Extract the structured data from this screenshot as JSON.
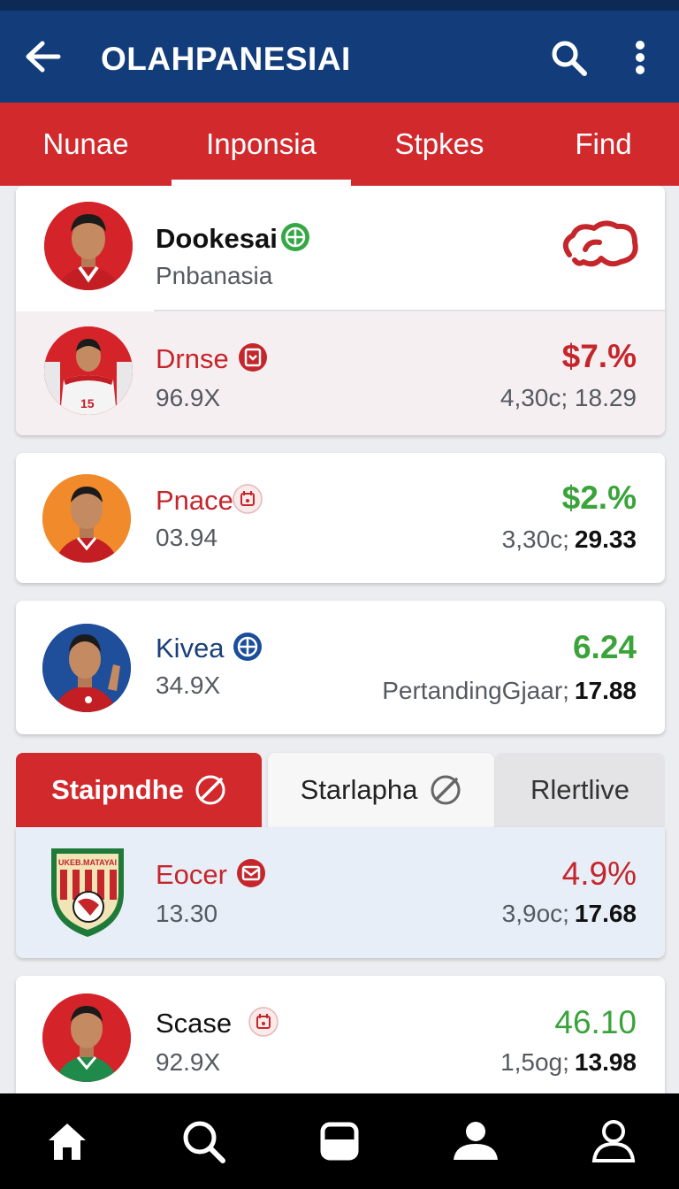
{
  "app_bar": {
    "title": "OLAHPANESIAI"
  },
  "tabs": [
    {
      "label": "Nunae"
    },
    {
      "label": "Inponsia"
    },
    {
      "label": "Stpkes"
    },
    {
      "label": "Find"
    }
  ],
  "card1": {
    "name": "Dookesai",
    "subtitle": "Pnbanasia",
    "row2": {
      "name": "Drnse",
      "sub": "96.9X",
      "pct": "$7.%",
      "stats": "4,30c; 18.29"
    }
  },
  "list": [
    {
      "name": "Pnace",
      "sub": "03.94",
      "pct": "$2.%",
      "stats_label": "3,30c;",
      "stats_value": "29.33"
    },
    {
      "name": "Kivea",
      "sub": "34.9X",
      "pct": "6.24",
      "stats_label": "PertandingGjaar;",
      "stats_value": "17.88"
    }
  ],
  "segments": [
    {
      "label": "Staipndhe"
    },
    {
      "label": "Starlapha"
    },
    {
      "label": "Rlertlive"
    }
  ],
  "list2": [
    {
      "name": "Eocer",
      "sub": "13.30",
      "pct": "4.9%",
      "stats_label": "3,9oc;",
      "stats_value": "17.68",
      "crest_text": "UKEB.MATAYAI"
    },
    {
      "name": "Scase",
      "sub": "92.9X",
      "pct": "46.10",
      "stats_label": "1,5og;",
      "stats_value": "13.98"
    }
  ],
  "colors": {
    "primary_blue": "#123d7a",
    "primary_red": "#d2292d",
    "positive_green": "#3aa33a",
    "negative_red": "#c4262b"
  },
  "bottom_nav": [
    {
      "icon": "home-icon"
    },
    {
      "icon": "search-icon"
    },
    {
      "icon": "window-icon"
    },
    {
      "icon": "person-icon"
    },
    {
      "icon": "person-outline-icon"
    }
  ]
}
